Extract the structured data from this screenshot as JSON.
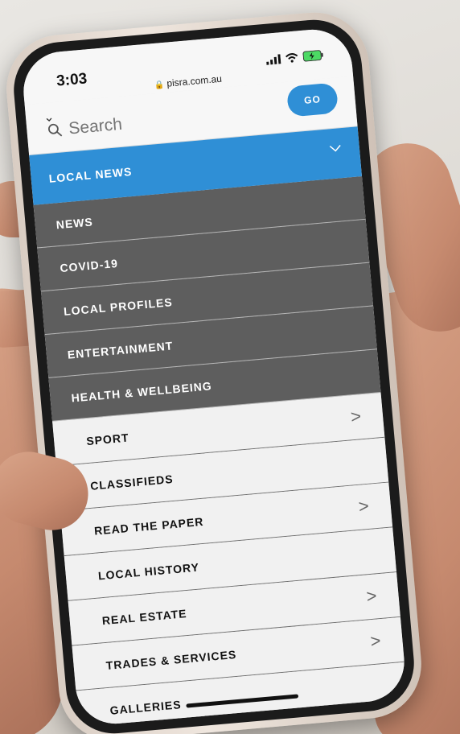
{
  "status_bar": {
    "time": "3:03",
    "url": "pisra.com.au"
  },
  "search": {
    "placeholder": "Search",
    "go_label": "GO"
  },
  "menu": {
    "header_label": "LOCAL NEWS",
    "submenu": [
      {
        "label": "NEWS"
      },
      {
        "label": "COVID-19"
      },
      {
        "label": "LOCAL PROFILES"
      },
      {
        "label": "ENTERTAINMENT"
      },
      {
        "label": "HEALTH & WELLBEING"
      }
    ],
    "items": [
      {
        "label": "SPORT",
        "has_arrow": true
      },
      {
        "label": "CLASSIFIEDS",
        "has_arrow": false
      },
      {
        "label": "READ THE PAPER",
        "has_arrow": true
      },
      {
        "label": "LOCAL HISTORY",
        "has_arrow": false
      },
      {
        "label": "REAL ESTATE",
        "has_arrow": true
      },
      {
        "label": "TRADES & SERVICES",
        "has_arrow": true
      },
      {
        "label": "GALLERIES",
        "has_arrow": false
      }
    ]
  },
  "colors": {
    "accent": "#2f8fd6",
    "submenu_bg": "#5e5e5e",
    "menu_bg": "#f1f1f1"
  },
  "icons": {
    "lock": "lock-icon",
    "search": "search-icon",
    "chevron_down": "chevron-down-icon",
    "chevron_right": "chevron-right-icon",
    "signal": "signal-icon",
    "wifi": "wifi-icon",
    "battery": "battery-charging-icon"
  }
}
